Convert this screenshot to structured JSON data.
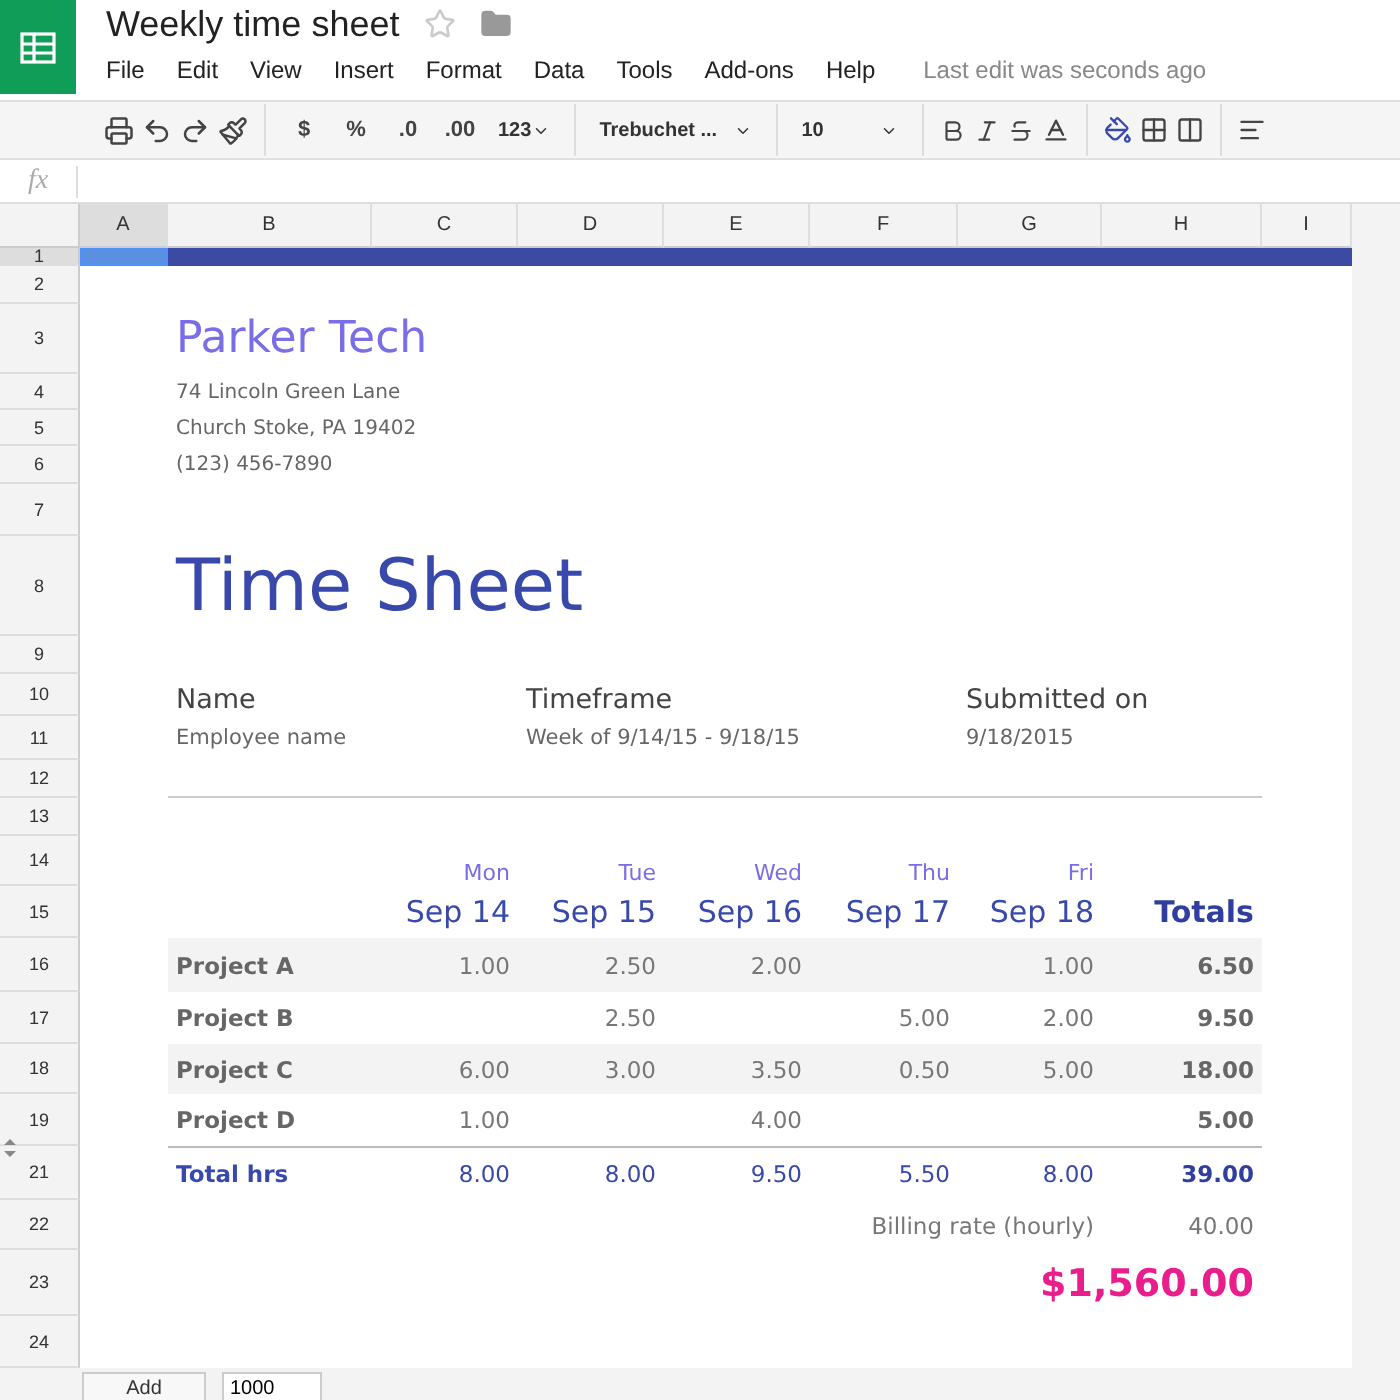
{
  "document": {
    "title": "Weekly time sheet",
    "last_edit": "Last edit was seconds ago"
  },
  "menus": [
    "File",
    "Edit",
    "View",
    "Insert",
    "Format",
    "Data",
    "Tools",
    "Add-ons",
    "Help"
  ],
  "toolbar": {
    "currency": "$",
    "percent": "%",
    "decrease_decimals": ".0",
    "increase_decimals": ".00",
    "number_format": "123",
    "font": "Trebuchet ...",
    "font_size": "10"
  },
  "formula_bar": {
    "label": "fx"
  },
  "columns": [
    {
      "label": "A",
      "selected": true
    },
    {
      "label": "B",
      "selected": false
    },
    {
      "label": "C",
      "selected": false
    },
    {
      "label": "D",
      "selected": false
    },
    {
      "label": "E",
      "selected": false
    },
    {
      "label": "F",
      "selected": false
    },
    {
      "label": "G",
      "selected": false
    },
    {
      "label": "H",
      "selected": false
    },
    {
      "label": "I",
      "selected": false
    }
  ],
  "rows": [
    {
      "label": "1",
      "selected": true,
      "hidden_after": false
    },
    {
      "label": "2",
      "selected": false,
      "hidden_after": false
    },
    {
      "label": "3",
      "selected": false,
      "hidden_after": false
    },
    {
      "label": "4",
      "selected": false,
      "hidden_after": false
    },
    {
      "label": "5",
      "selected": false,
      "hidden_after": false
    },
    {
      "label": "6",
      "selected": false,
      "hidden_after": false
    },
    {
      "label": "7",
      "selected": false,
      "hidden_after": false
    },
    {
      "label": "8",
      "selected": false,
      "hidden_after": false
    },
    {
      "label": "9",
      "selected": false,
      "hidden_after": false
    },
    {
      "label": "10",
      "selected": false,
      "hidden_after": false
    },
    {
      "label": "11",
      "selected": false,
      "hidden_after": false
    },
    {
      "label": "12",
      "selected": false,
      "hidden_after": false
    },
    {
      "label": "13",
      "selected": false,
      "hidden_after": false
    },
    {
      "label": "14",
      "selected": false,
      "hidden_after": false
    },
    {
      "label": "15",
      "selected": false,
      "hidden_after": false
    },
    {
      "label": "16",
      "selected": false,
      "hidden_after": false
    },
    {
      "label": "17",
      "selected": false,
      "hidden_after": false
    },
    {
      "label": "18",
      "selected": false,
      "hidden_after": false
    },
    {
      "label": "19",
      "selected": false,
      "hidden_after": true
    },
    {
      "label": "21",
      "selected": false,
      "hidden_after": false
    },
    {
      "label": "22",
      "selected": false,
      "hidden_after": false
    },
    {
      "label": "23",
      "selected": false,
      "hidden_after": false
    },
    {
      "label": "24",
      "selected": false,
      "hidden_after": false
    }
  ],
  "company": {
    "name": "Parker Tech",
    "address": [
      "74 Lincoln Green Lane",
      "Church Stoke, PA 19402",
      "(123) 456-7890"
    ]
  },
  "heading": "Time Sheet",
  "info": [
    {
      "label": "Name",
      "value": "Employee name"
    },
    {
      "label": "Timeframe",
      "value": "Week of 9/14/15 - 9/18/15"
    },
    {
      "label": "Submitted on",
      "value": "9/18/2015"
    }
  ],
  "timesheet": {
    "days": [
      {
        "day": "Mon",
        "date": "Sep 14"
      },
      {
        "day": "Tue",
        "date": "Sep 15"
      },
      {
        "day": "Wed",
        "date": "Sep 16"
      },
      {
        "day": "Thu",
        "date": "Sep 17"
      },
      {
        "day": "Fri",
        "date": "Sep 18"
      }
    ],
    "totals_header": "Totals",
    "projects": [
      {
        "name": "Project A",
        "hours": {
          "mon": "1.00",
          "tue": "2.50",
          "wed": "2.00",
          "fri": "1.00"
        },
        "total": "6.50"
      },
      {
        "name": "Project B",
        "hours": {
          "tue": "2.50",
          "thu": "5.00",
          "fri": "2.00"
        },
        "total": "9.50"
      },
      {
        "name": "Project C",
        "hours": {
          "mon": "6.00",
          "tue": "3.00",
          "wed": "3.50",
          "thu": "0.50",
          "fri": "5.00"
        },
        "total": "18.00"
      },
      {
        "name": "Project D",
        "hours": {
          "mon": "1.00",
          "wed": "4.00"
        },
        "total": "5.00"
      }
    ],
    "total_row": {
      "label": "Total hrs",
      "hours": [
        "8.00",
        "8.00",
        "9.50",
        "5.50",
        "8.00"
      ],
      "total": "39.00"
    },
    "billing": {
      "label": "Billing rate (hourly)",
      "value": "40.00"
    },
    "amount": "$1,560.00"
  },
  "footer": {
    "add_button": "Add",
    "rows_field": "1000"
  }
}
